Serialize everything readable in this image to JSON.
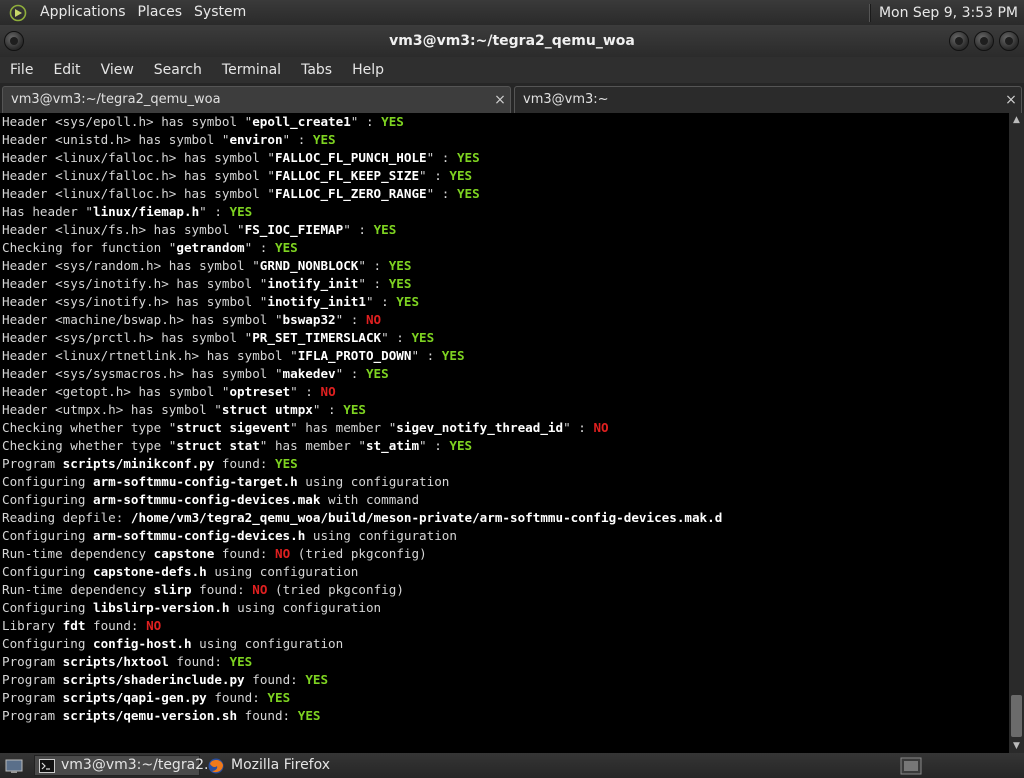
{
  "panel": {
    "menus": [
      "Applications",
      "Places",
      "System"
    ],
    "clock": "Mon Sep  9,  3:53 PM"
  },
  "window": {
    "title": "vm3@vm3:~/tegra2_qemu_woa"
  },
  "menubar": [
    "File",
    "Edit",
    "View",
    "Search",
    "Terminal",
    "Tabs",
    "Help"
  ],
  "tabs": [
    {
      "label": "vm3@vm3:~/tegra2_qemu_woa",
      "close": "×"
    },
    {
      "label": "vm3@vm3:~",
      "close": "×"
    }
  ],
  "terminal": {
    "lines": [
      [
        [
          "Header <sys/epoll.h> has symbol \"",
          ""
        ],
        [
          "epoll_create1",
          "b"
        ],
        [
          "\" : ",
          ""
        ],
        [
          "YES",
          "yes"
        ]
      ],
      [
        [
          "Header <unistd.h> has symbol \"",
          ""
        ],
        [
          "environ",
          "b"
        ],
        [
          "\" : ",
          ""
        ],
        [
          "YES",
          "yes"
        ]
      ],
      [
        [
          "Header <linux/falloc.h> has symbol \"",
          ""
        ],
        [
          "FALLOC_FL_PUNCH_HOLE",
          "b"
        ],
        [
          "\" : ",
          ""
        ],
        [
          "YES",
          "yes"
        ]
      ],
      [
        [
          "Header <linux/falloc.h> has symbol \"",
          ""
        ],
        [
          "FALLOC_FL_KEEP_SIZE",
          "b"
        ],
        [
          "\" : ",
          ""
        ],
        [
          "YES",
          "yes"
        ]
      ],
      [
        [
          "Header <linux/falloc.h> has symbol \"",
          ""
        ],
        [
          "FALLOC_FL_ZERO_RANGE",
          "b"
        ],
        [
          "\" : ",
          ""
        ],
        [
          "YES",
          "yes"
        ]
      ],
      [
        [
          "Has header \"",
          ""
        ],
        [
          "linux/fiemap.h",
          "b"
        ],
        [
          "\" : ",
          ""
        ],
        [
          "YES",
          "yes"
        ]
      ],
      [
        [
          "Header <linux/fs.h> has symbol \"",
          ""
        ],
        [
          "FS_IOC_FIEMAP",
          "b"
        ],
        [
          "\" : ",
          ""
        ],
        [
          "YES",
          "yes"
        ]
      ],
      [
        [
          "Checking for function \"",
          ""
        ],
        [
          "getrandom",
          "b"
        ],
        [
          "\" : ",
          ""
        ],
        [
          "YES",
          "yes"
        ]
      ],
      [
        [
          "Header <sys/random.h> has symbol \"",
          ""
        ],
        [
          "GRND_NONBLOCK",
          "b"
        ],
        [
          "\" : ",
          ""
        ],
        [
          "YES",
          "yes"
        ]
      ],
      [
        [
          "Header <sys/inotify.h> has symbol \"",
          ""
        ],
        [
          "inotify_init",
          "b"
        ],
        [
          "\" : ",
          ""
        ],
        [
          "YES",
          "yes"
        ]
      ],
      [
        [
          "Header <sys/inotify.h> has symbol \"",
          ""
        ],
        [
          "inotify_init1",
          "b"
        ],
        [
          "\" : ",
          ""
        ],
        [
          "YES",
          "yes"
        ]
      ],
      [
        [
          "Header <machine/bswap.h> has symbol \"",
          ""
        ],
        [
          "bswap32",
          "b"
        ],
        [
          "\" : ",
          ""
        ],
        [
          "NO",
          "no"
        ]
      ],
      [
        [
          "Header <sys/prctl.h> has symbol \"",
          ""
        ],
        [
          "PR_SET_TIMERSLACK",
          "b"
        ],
        [
          "\" : ",
          ""
        ],
        [
          "YES",
          "yes"
        ]
      ],
      [
        [
          "Header <linux/rtnetlink.h> has symbol \"",
          ""
        ],
        [
          "IFLA_PROTO_DOWN",
          "b"
        ],
        [
          "\" : ",
          ""
        ],
        [
          "YES",
          "yes"
        ]
      ],
      [
        [
          "Header <sys/sysmacros.h> has symbol \"",
          ""
        ],
        [
          "makedev",
          "b"
        ],
        [
          "\" : ",
          ""
        ],
        [
          "YES",
          "yes"
        ]
      ],
      [
        [
          "Header <getopt.h> has symbol \"",
          ""
        ],
        [
          "optreset",
          "b"
        ],
        [
          "\" : ",
          ""
        ],
        [
          "NO",
          "no"
        ]
      ],
      [
        [
          "Header <utmpx.h> has symbol \"",
          ""
        ],
        [
          "struct utmpx",
          "b"
        ],
        [
          "\" : ",
          ""
        ],
        [
          "YES",
          "yes"
        ]
      ],
      [
        [
          "Checking whether type \"",
          ""
        ],
        [
          "struct sigevent",
          "b"
        ],
        [
          "\" has member \"",
          ""
        ],
        [
          "sigev_notify_thread_id",
          "b"
        ],
        [
          "\" : ",
          ""
        ],
        [
          "NO",
          "no"
        ]
      ],
      [
        [
          "Checking whether type \"",
          ""
        ],
        [
          "struct stat",
          "b"
        ],
        [
          "\" has member \"",
          ""
        ],
        [
          "st_atim",
          "b"
        ],
        [
          "\" : ",
          ""
        ],
        [
          "YES",
          "yes"
        ]
      ],
      [
        [
          "Program ",
          ""
        ],
        [
          "scripts/minikconf.py",
          "b"
        ],
        [
          " found: ",
          ""
        ],
        [
          "YES",
          "yes"
        ]
      ],
      [
        [
          "Configuring ",
          ""
        ],
        [
          "arm-softmmu-config-target.h",
          "b"
        ],
        [
          " using configuration",
          ""
        ]
      ],
      [
        [
          "Configuring ",
          ""
        ],
        [
          "arm-softmmu-config-devices.mak",
          "b"
        ],
        [
          " with command",
          ""
        ]
      ],
      [
        [
          "Reading depfile: ",
          ""
        ],
        [
          "/home/vm3/tegra2_qemu_woa/build/meson-private/arm-softmmu-config-devices.mak.d",
          "b"
        ]
      ],
      [
        [
          "Configuring ",
          ""
        ],
        [
          "arm-softmmu-config-devices.h",
          "b"
        ],
        [
          " using configuration",
          ""
        ]
      ],
      [
        [
          "Run-time dependency ",
          ""
        ],
        [
          "capstone",
          "b"
        ],
        [
          " found: ",
          ""
        ],
        [
          "NO",
          "no"
        ],
        [
          " (tried pkgconfig)",
          ""
        ]
      ],
      [
        [
          "Configuring ",
          ""
        ],
        [
          "capstone-defs.h",
          "b"
        ],
        [
          " using configuration",
          ""
        ]
      ],
      [
        [
          "Run-time dependency ",
          ""
        ],
        [
          "slirp",
          "b"
        ],
        [
          " found: ",
          ""
        ],
        [
          "NO",
          "no"
        ],
        [
          " (tried pkgconfig)",
          ""
        ]
      ],
      [
        [
          "Configuring ",
          ""
        ],
        [
          "libslirp-version.h",
          "b"
        ],
        [
          " using configuration",
          ""
        ]
      ],
      [
        [
          "Library ",
          ""
        ],
        [
          "fdt",
          "b"
        ],
        [
          " found: ",
          ""
        ],
        [
          "NO",
          "no"
        ]
      ],
      [
        [
          "Configuring ",
          ""
        ],
        [
          "config-host.h",
          "b"
        ],
        [
          " using configuration",
          ""
        ]
      ],
      [
        [
          "Program ",
          ""
        ],
        [
          "scripts/hxtool",
          "b"
        ],
        [
          " found: ",
          ""
        ],
        [
          "YES",
          "yes"
        ]
      ],
      [
        [
          "Program ",
          ""
        ],
        [
          "scripts/shaderinclude.py",
          "b"
        ],
        [
          " found: ",
          ""
        ],
        [
          "YES",
          "yes"
        ]
      ],
      [
        [
          "Program ",
          ""
        ],
        [
          "scripts/qapi-gen.py",
          "b"
        ],
        [
          " found: ",
          ""
        ],
        [
          "YES",
          "yes"
        ]
      ],
      [
        [
          "Program ",
          ""
        ],
        [
          "scripts/qemu-version.sh",
          "b"
        ],
        [
          " found: ",
          ""
        ],
        [
          "YES",
          "yes"
        ]
      ]
    ]
  },
  "taskbar": {
    "items": [
      {
        "label": "vm3@vm3:~/tegra2...",
        "icon": "terminal-icon"
      },
      {
        "label": "Mozilla Firefox",
        "icon": "firefox-icon"
      }
    ]
  },
  "icons": {
    "panel_logo": "gnome-foot-icon",
    "desktop": "show-desktop-icon",
    "switcher": "workspace-switcher-icon"
  },
  "colors": {
    "yes": "#7ed321",
    "no": "#e02020",
    "terminal_bg": "#000000"
  }
}
